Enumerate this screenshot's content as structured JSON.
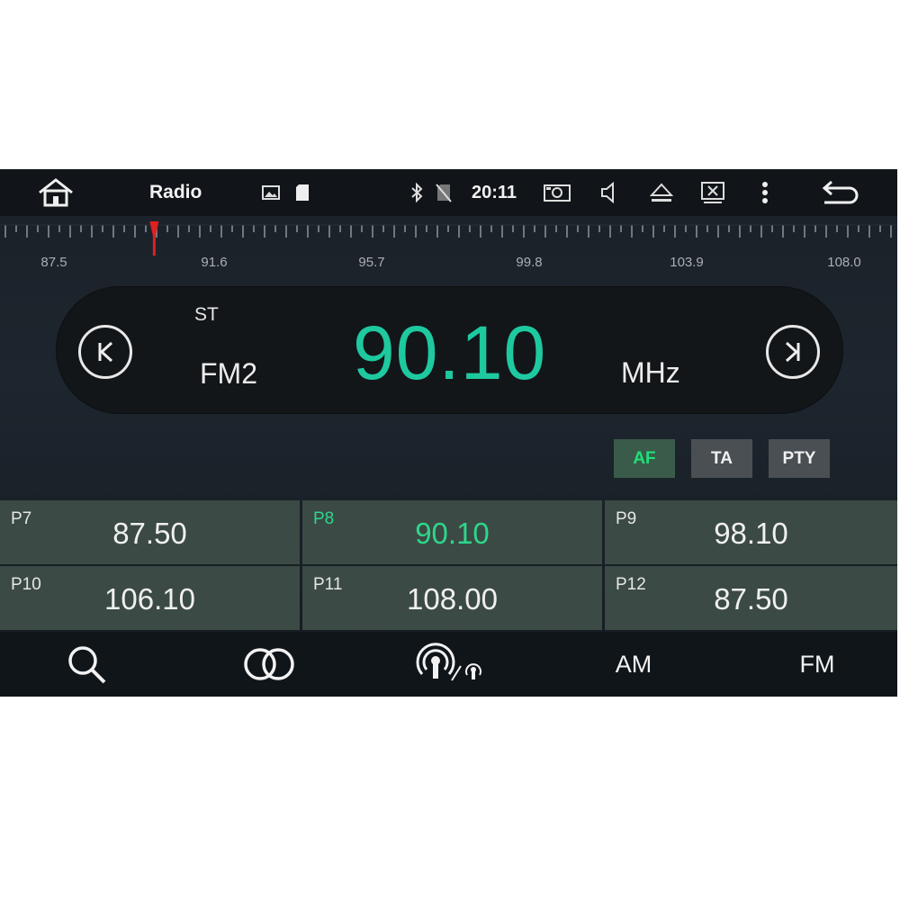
{
  "status_bar": {
    "app_title": "Radio",
    "time": "20:11",
    "icons": [
      "home-icon",
      "gallery-icon",
      "sd-card-icon",
      "bluetooth-icon",
      "no-sim-icon",
      "screenshot-icon",
      "volume-icon",
      "eject-icon",
      "close-window-icon",
      "more-menu-icon",
      "back-icon"
    ]
  },
  "tuner": {
    "scale_labels": [
      "87.5",
      "91.6",
      "95.7",
      "99.8",
      "103.9",
      "108.0"
    ],
    "stereo": "ST",
    "band": "FM2",
    "frequency": "90.10",
    "unit": "MHz"
  },
  "toggles": {
    "af": "AF",
    "ta": "TA",
    "pty": "PTY",
    "af_active": true
  },
  "presets": [
    {
      "label": "P7",
      "freq": "87.50",
      "active": false
    },
    {
      "label": "P8",
      "freq": "90.10",
      "active": true
    },
    {
      "label": "P9",
      "freq": "98.10",
      "active": false
    },
    {
      "label": "P10",
      "freq": "106.10",
      "active": false
    },
    {
      "label": "P11",
      "freq": "108.00",
      "active": false
    },
    {
      "label": "P12",
      "freq": "87.50",
      "active": false
    }
  ],
  "bottom_bar": {
    "am": "AM",
    "fm": "FM",
    "icons": [
      "search-icon",
      "stereo-icon",
      "rds-signal-icon"
    ]
  },
  "colors": {
    "accent_teal": "#1ec9a0",
    "accent_green": "#2ed68a",
    "needle": "#e02020"
  }
}
